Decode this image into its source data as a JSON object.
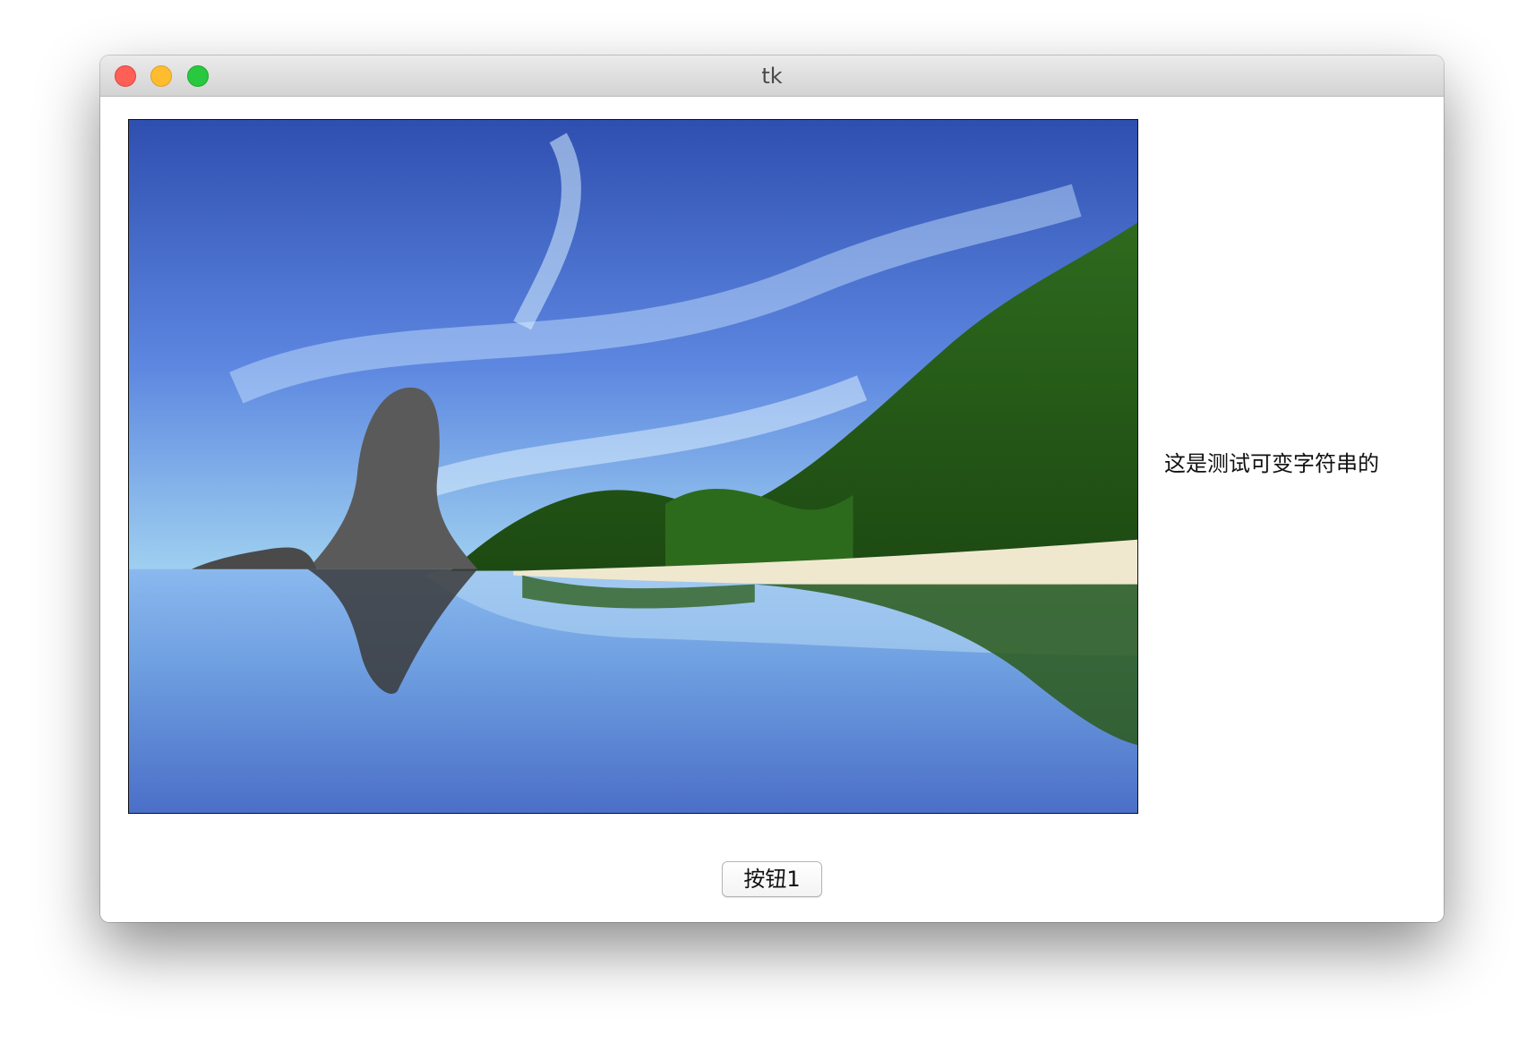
{
  "window": {
    "title": "tk"
  },
  "main": {
    "image": {
      "description_icon": "landscape-photo"
    },
    "variable_label": "这是测试可变字符串的",
    "button1_label": "按钮1"
  }
}
